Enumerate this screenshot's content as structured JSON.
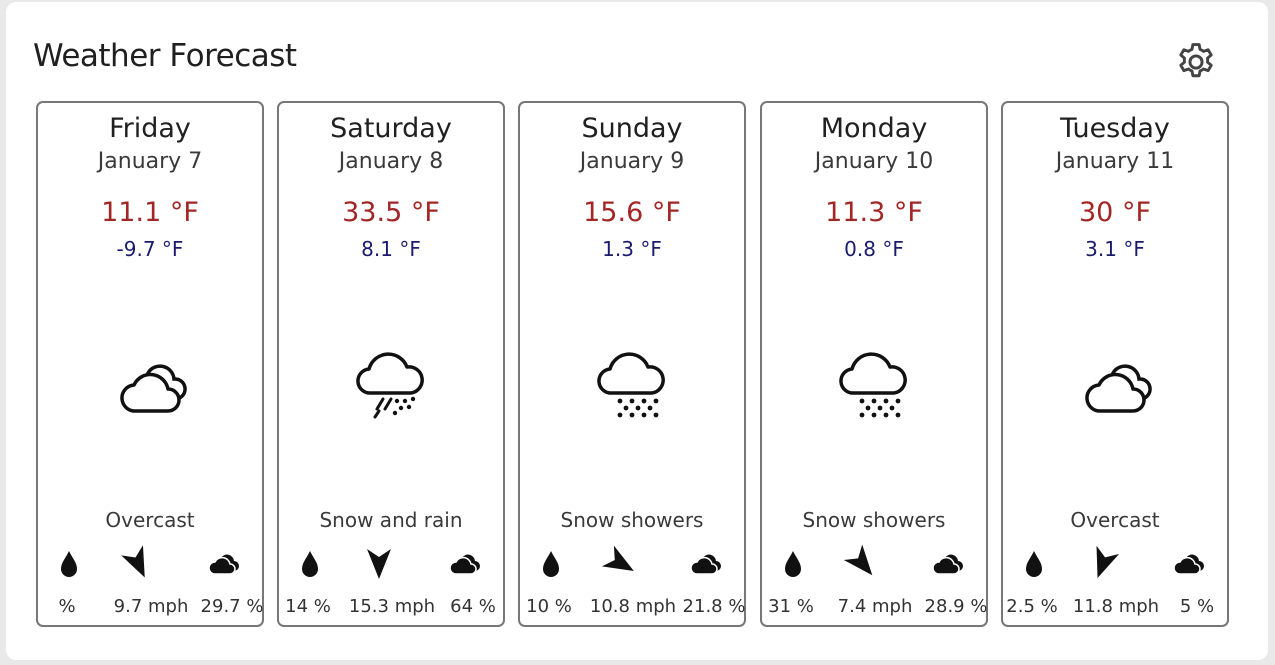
{
  "title": "Weather Forecast",
  "settings_icon": "gear-icon",
  "colors": {
    "high_temp": "#a32626",
    "low_temp": "#1b1b6e",
    "border": "#777777"
  },
  "days": [
    {
      "name": "Friday",
      "date": "January 7",
      "high": "11.1 °F",
      "low": "-9.7 °F",
      "icon": "overcast-icon",
      "condition": "Overcast",
      "precip": "%",
      "wind": "9.7 mph",
      "wind_direction_deg": 155,
      "cloud": "29.7 %"
    },
    {
      "name": "Saturday",
      "date": "January 8",
      "high": "33.5 °F",
      "low": "8.1 °F",
      "icon": "snow-and-rain-icon",
      "condition": "Snow and rain",
      "precip": "14 %",
      "wind": "15.3 mph",
      "wind_direction_deg": 180,
      "cloud": "64 %"
    },
    {
      "name": "Sunday",
      "date": "January 9",
      "high": "15.6 °F",
      "low": "1.3 °F",
      "icon": "snow-showers-icon",
      "condition": "Snow showers",
      "precip": "10 %",
      "wind": "10.8 mph",
      "wind_direction_deg": 120,
      "cloud": "21.8 %"
    },
    {
      "name": "Monday",
      "date": "January 10",
      "high": "11.3 °F",
      "low": "0.8 °F",
      "icon": "snow-showers-icon",
      "condition": "Snow showers",
      "precip": "31 %",
      "wind": "7.4 mph",
      "wind_direction_deg": 140,
      "cloud": "28.9 %"
    },
    {
      "name": "Tuesday",
      "date": "January 11",
      "high": "30 °F",
      "low": "3.1 °F",
      "icon": "overcast-icon",
      "condition": "Overcast",
      "precip": "2.5 %",
      "wind": "11.8 mph",
      "wind_direction_deg": 200,
      "cloud": "5 %"
    }
  ]
}
